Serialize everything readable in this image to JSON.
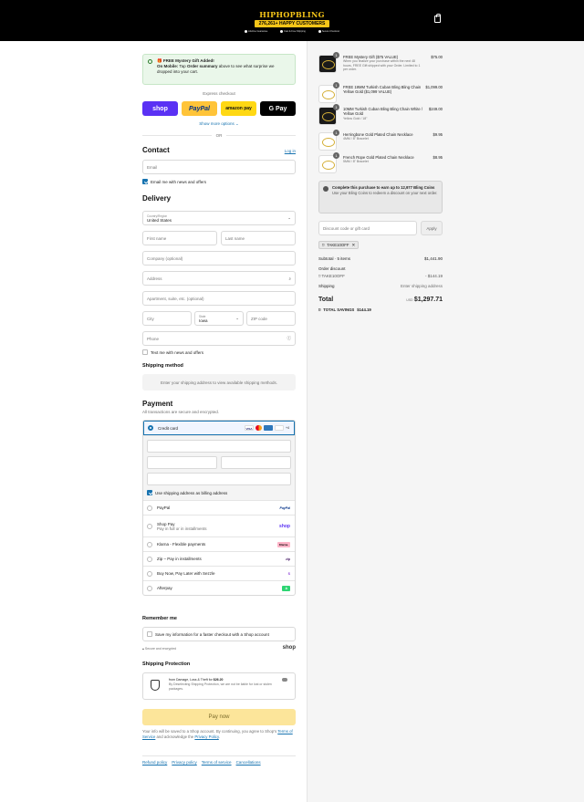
{
  "header": {
    "brand": "HIPHOPBLING",
    "badge": "276,261+ HAPPY CUSTOMERS",
    "trust": [
      "Lifetime Guarantee",
      "Fast & Free Shipping",
      "Secure Checkout"
    ]
  },
  "gift_banner": {
    "title": "🎁 FREE Mystery Gift Added!",
    "mobile_label": "On Mobile:",
    "mobile_text_1": "Tap",
    "order_summary": "Order summary",
    "mobile_text_2": "above to see what surprise we dropped into your cart."
  },
  "express": {
    "label": "Express checkout",
    "shop": "shop",
    "paypal": "PayPal",
    "amazon": "amazon pay",
    "gpay": "G Pay",
    "more": "Show more options",
    "or": "OR"
  },
  "contact": {
    "title": "Contact",
    "login": "Log in",
    "email_placeholder": "Email",
    "newsletter": "Email me with news and offers"
  },
  "delivery": {
    "title": "Delivery",
    "country_label": "Country/Region",
    "country_value": "United States",
    "first_name": "First name",
    "last_name": "Last name",
    "company": "Company (optional)",
    "address": "Address",
    "apartment": "Apartment, suite, etc. (optional)",
    "city": "City",
    "state_label": "State",
    "state_value": "Iowa",
    "zip": "ZIP code",
    "phone": "Phone",
    "sms": "Text me with news and offers"
  },
  "shipping_method": {
    "title": "Shipping method",
    "note": "Enter your shipping address to view available shipping methods."
  },
  "payment": {
    "title": "Payment",
    "subtitle": "All transactions are secure and encrypted.",
    "credit_card": "Credit card",
    "card_more": "+4",
    "billing_same": "Use shipping address as billing address",
    "methods": [
      {
        "label": "PayPal",
        "sub": "",
        "tag": "PayPal"
      },
      {
        "label": "Shop Pay",
        "sub": "Pay in full or in installments",
        "tag": "shop"
      },
      {
        "label": "Klarna - Flexible payments",
        "sub": "",
        "tag": "Klarna."
      },
      {
        "label": "Zip – Pay in installments",
        "sub": "",
        "tag": "zip"
      },
      {
        "label": "Buy Now, Pay Later with Sezzle",
        "sub": "",
        "tag": "S"
      },
      {
        "label": "Afterpay",
        "sub": "",
        "tag": "A"
      }
    ]
  },
  "remember": {
    "title": "Remember me",
    "save": "Save my information for a faster checkout with a Shop account",
    "secure": "Secure and encrypted",
    "shop": "shop"
  },
  "protection": {
    "title": "Shipping Protection",
    "line1_prefix": "from Damage, Loss & Theft for",
    "line1_price": "$26.20",
    "line2": "By Deselecting Shipping Protection, we are not be liable for lost or stolen packages."
  },
  "pay_now": "Pay now",
  "legal": {
    "text1": "Your info will be saved to a Shop account. By continuing, you agree to Shop's",
    "tos": "Terms of Service",
    "text2": "and acknowledge the",
    "privacy": "Privacy Policy",
    "text3": "."
  },
  "footer_links": [
    "Refund policy",
    "Privacy policy",
    "Terms of service",
    "Cancellations"
  ],
  "cart": {
    "items": [
      {
        "qty": "1",
        "name": "FREE Mystery Gift ($75 VALUE)",
        "variant": "When you finalize your purchase within the next 48 hours, FREE Gift shipped with your Order. Limited to 1 per order.",
        "price": "$75.00"
      },
      {
        "qty": "1",
        "name": "FREE 19MM Turkish Cuban Bling Bling Chain Yellow Gold ($1,099 VALUE)",
        "variant": "",
        "price": "$1,099.00"
      },
      {
        "qty": "1",
        "name": "10MM Turkish Cuban Bling Bling Chain White / Yellow Gold",
        "variant": "Yellow Gold / 18\"",
        "price": "$249.00"
      },
      {
        "qty": "1",
        "name": "Herringbone Gold Plated Chain Necklace",
        "variant": "4MM / 8\" Bracelet",
        "price": "$9.95"
      },
      {
        "qty": "1",
        "name": "French Rope Gold Plated Chain Necklace",
        "variant": "5MM / 8\" Bracelet",
        "price": "$8.95"
      }
    ],
    "coins_title": "Complete this purchase to earn up to 12,977 Bling Coins",
    "coins_text": "Use your Bling Coins to redeem a discount on your next order.",
    "discount_placeholder": "Discount code or gift card",
    "apply": "Apply",
    "code": "TAKE10OFF",
    "subtotal_label": "Subtotal · 5 items",
    "subtotal": "$1,441.90",
    "order_discount": "Order discount",
    "discount_code": "TAKE10OFF",
    "discount_value": "- $144.19",
    "shipping_label": "Shipping",
    "shipping_value": "Enter shipping address",
    "total_label": "Total",
    "currency": "USD",
    "total": "$1,297.71",
    "savings_label": "TOTAL SAVINGS",
    "savings": "$144.19"
  }
}
